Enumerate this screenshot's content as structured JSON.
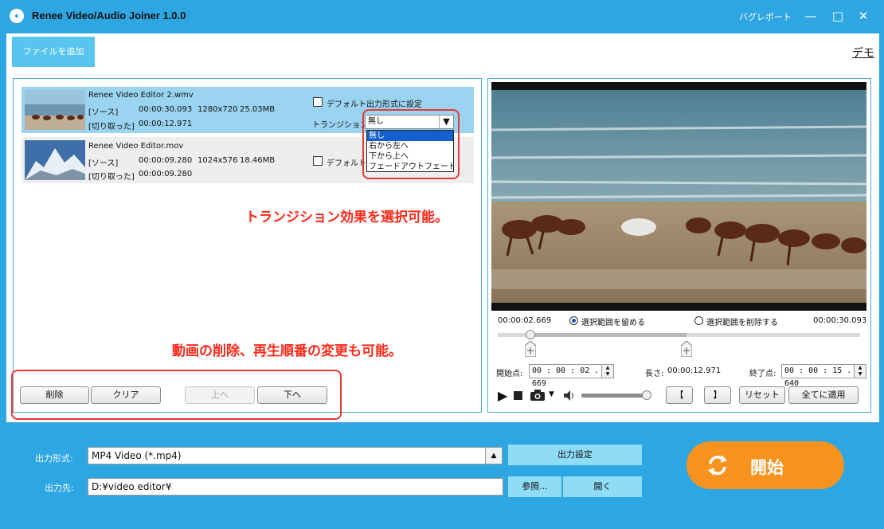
{
  "window": {
    "title": "Renee Video/Audio Joiner 1.0.0",
    "bug_report": "バグレポート",
    "minimize": "—",
    "maximize": "□",
    "close": "✕"
  },
  "toolbar": {
    "add_files": "ファイルを追加",
    "demo": "デモ"
  },
  "files": [
    {
      "name": "Renee Video Editor 2.wmv",
      "source_label": "[ソース]",
      "duration": "00:00:30.093",
      "resolution": "1280x720",
      "size": "25.03MB",
      "cut_label": "[切り取った]",
      "cut_duration": "00:00:12.971",
      "default_label": "デフォルト出力形式に設定",
      "transition_label": "トランジション:",
      "transition_value": "無し"
    },
    {
      "name": "Renee Video Editor.mov",
      "source_label": "[ソース]",
      "duration": "00:00:09.280",
      "resolution": "1024x576",
      "size": "18.46MB",
      "cut_label": "[切り取った]",
      "cut_duration": "00:00:09.280",
      "default_label": "デフォルト出"
    }
  ],
  "transition_options": [
    "無し",
    "右から左へ",
    "下から上へ",
    "フェードアウトフェードイン"
  ],
  "annotations": {
    "transition": "トランジション効果を選択可能。",
    "order": "動画の削除、再生順番の変更も可能。"
  },
  "list_buttons": {
    "delete": "削除",
    "clear": "クリア",
    "up": "上へ",
    "down": "下へ"
  },
  "preview": {
    "current_time": "00:00:02.669",
    "total_time": "00:00:30.093",
    "keep_label": "選択範囲を留める",
    "remove_label": "選択範囲を削除する",
    "start_label": "開始点:",
    "start_value": "00 : 00 : 02 . 669",
    "length_label": "長さ:",
    "length_value": "00:00:12.971",
    "end_label": "終了点:",
    "end_value": "00 : 00 : 15 . 640",
    "mark_in": "【",
    "mark_out": "】",
    "reset": "リセット",
    "apply_all": "全てに適用",
    "trim_start_fraction": 0.09,
    "trim_end_fraction": 0.52,
    "volume_fraction": 1.0
  },
  "output": {
    "format_label": "出力形式:",
    "format_value": "MP4 Video (*.mp4)",
    "settings": "出力設定",
    "dest_label": "出力先:",
    "dest_value": "D:¥video editor¥",
    "browse": "参照...",
    "open": "開く"
  },
  "start_button": {
    "label": "開始"
  },
  "colors": {
    "accent": "#2ea6e2",
    "start": "#f7931e",
    "annotation": "#ff2a1a",
    "selected_row": "#9ad4f1"
  }
}
